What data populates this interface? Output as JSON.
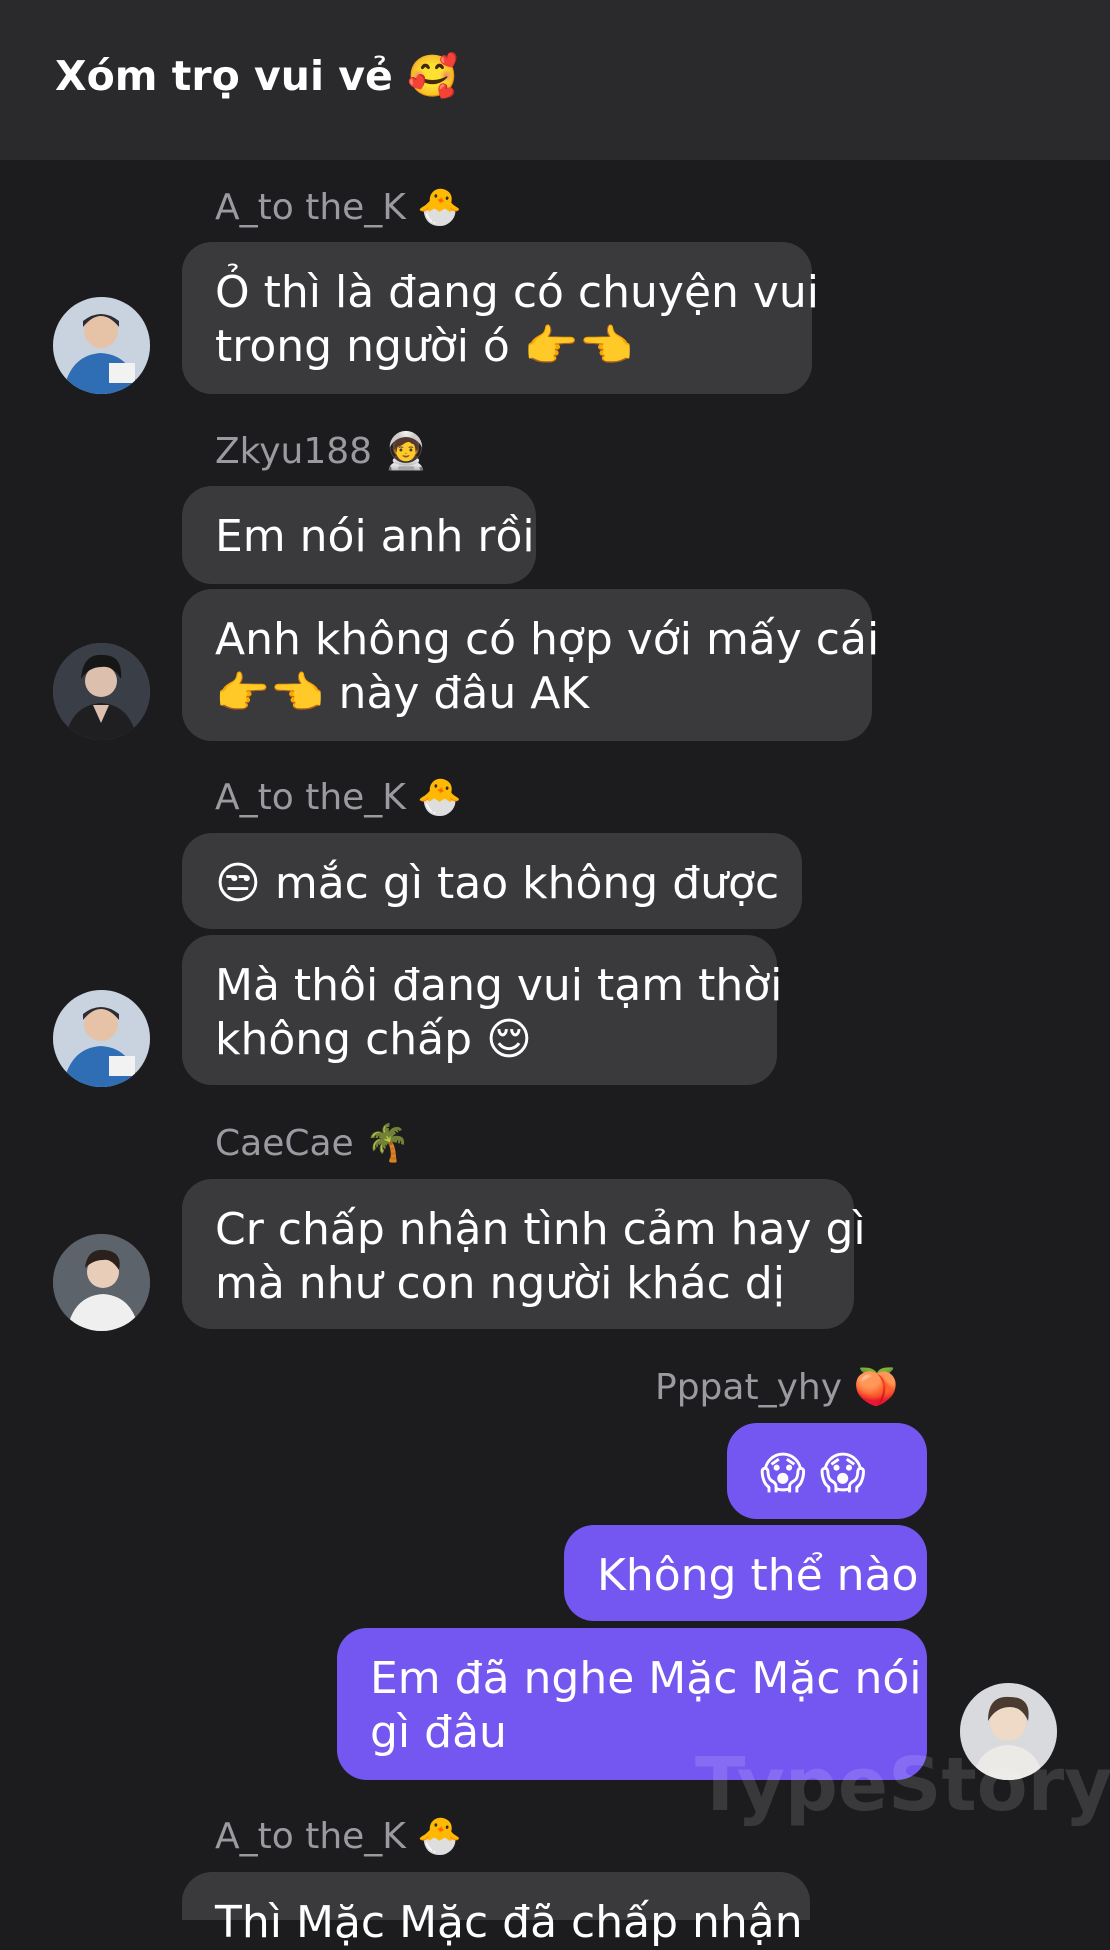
{
  "header": {
    "title": "Xóm trọ vui vẻ",
    "title_emoji": "🥰"
  },
  "colors": {
    "background": "#1c1c1e",
    "header": "#2a2a2c",
    "incoming_bubble": "#3a3a3c",
    "outgoing_bubble": "#7357f0",
    "sender_name": "#9a9aa0"
  },
  "groups": [
    {
      "sender": "A_to the_K",
      "sender_emoji": "🐣",
      "messages": [
        {
          "lines": [
            "Ỏ thì là đang có chuyện vui",
            "trong người ó 👉👈"
          ]
        }
      ]
    },
    {
      "sender": "Zkyu188",
      "sender_emoji": "🧑‍🚀",
      "messages": [
        {
          "lines": [
            "Em nói anh rồi"
          ]
        },
        {
          "lines": [
            "Anh không có hợp với mấy cái",
            "👉👈 này đâu AK"
          ]
        }
      ]
    },
    {
      "sender": "A_to the_K",
      "sender_emoji": "🐣",
      "messages": [
        {
          "lines": [
            "😒 mắc gì tao không được"
          ]
        },
        {
          "lines": [
            "Mà thôi đang vui tạm thời",
            "không chấp 😌"
          ]
        }
      ]
    },
    {
      "sender": "CaeCae",
      "sender_emoji": "🌴",
      "messages": [
        {
          "lines": [
            "Cr chấp nhận tình cảm hay gì",
            "mà như con người khác dị"
          ]
        }
      ]
    },
    {
      "sender": "Pppat_yhy",
      "sender_emoji": "🍑",
      "outgoing": true,
      "messages": [
        {
          "lines": [
            "😱 😱"
          ]
        },
        {
          "lines": [
            "Không thể nào"
          ]
        },
        {
          "lines": [
            "Em đã nghe Mặc Mặc nói",
            "gì đâu"
          ]
        }
      ]
    },
    {
      "sender": "A_to the_K",
      "sender_emoji": "🐣",
      "messages": [
        {
          "lines": [
            "Thì Mặc Mặc đã chấp nhận"
          ]
        }
      ]
    }
  ],
  "watermark": "TypeStory"
}
